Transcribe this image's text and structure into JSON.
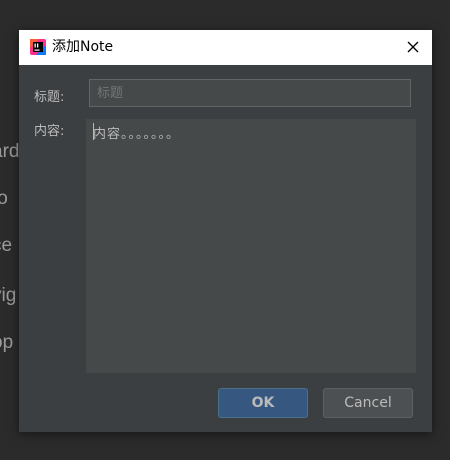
{
  "background": {
    "fragments": [
      "ard",
      "to",
      "ce",
      "vig",
      "op"
    ]
  },
  "dialog": {
    "title": "添加Note",
    "icon": "intellij-app-icon",
    "close_icon": "close-icon",
    "title_label": "标题:",
    "title_value": "",
    "title_placeholder": "标题",
    "content_label": "内容:",
    "content_value": "内容。。。。。。。",
    "ok_label": "OK",
    "cancel_label": "Cancel"
  },
  "colors": {
    "dialog_bg": "#3c3f41",
    "field_bg": "#45494a",
    "ok_button": "#365880",
    "cancel_button": "#4c5052",
    "text": "#bbbbbb"
  }
}
